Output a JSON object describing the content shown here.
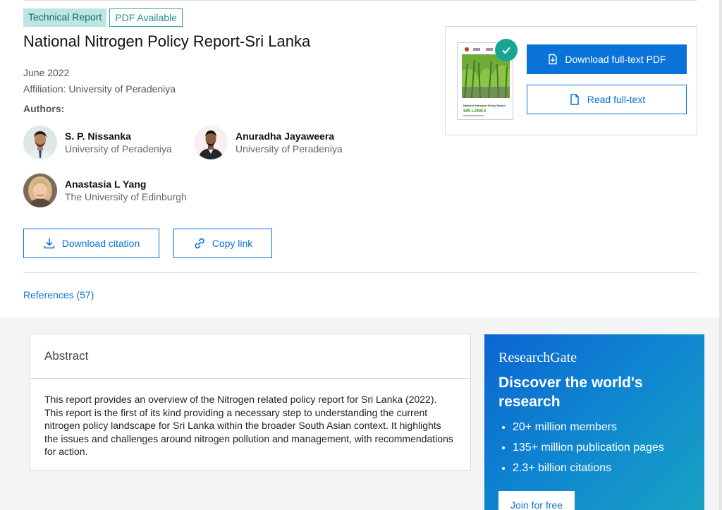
{
  "badges": {
    "tech": "Technical Report",
    "pdf": "PDF Available"
  },
  "publication": {
    "title": "National Nitrogen Policy Report-Sri Lanka",
    "date": "June 2022",
    "affiliation": "Affiliation: University of Peradeniya",
    "authors_label": "Authors:"
  },
  "authors": [
    {
      "name": "S. P. Nissanka",
      "institution": "University of Peradeniya"
    },
    {
      "name": "Anuradha Jayaweera",
      "institution": "University of Peradeniya"
    },
    {
      "name": "Anastasia L Yang",
      "institution": "The University of Edinburgh"
    }
  ],
  "actions": {
    "download_citation": "Download citation",
    "copy_link": "Copy link"
  },
  "references": "References (57)",
  "pdf_card": {
    "download": "Download full-text PDF",
    "read": "Read full-text",
    "thumb_title": "National Nitrogen Policy Report",
    "thumb_country": "SRI LANKA"
  },
  "abstract": {
    "heading": "Abstract",
    "text": "This report provides an overview of the Nitrogen related policy report for Sri Lanka (2022). This report is the first of its kind providing a necessary step to understanding the current nitrogen policy landscape for Sri Lanka within the broader South Asian context. It highlights the issues and challenges around nitrogen pollution and management, with recommendations for action."
  },
  "promo": {
    "logo": "ResearchGate",
    "heading": "Discover the world's research",
    "stats": [
      "20+ million members",
      "135+ million publication pages",
      "2.3+ billion citations"
    ],
    "join": "Join for free"
  },
  "colors": {
    "accent": "#0a73d9",
    "teal": "#18a595",
    "badge_bg": "#bde5e2"
  }
}
